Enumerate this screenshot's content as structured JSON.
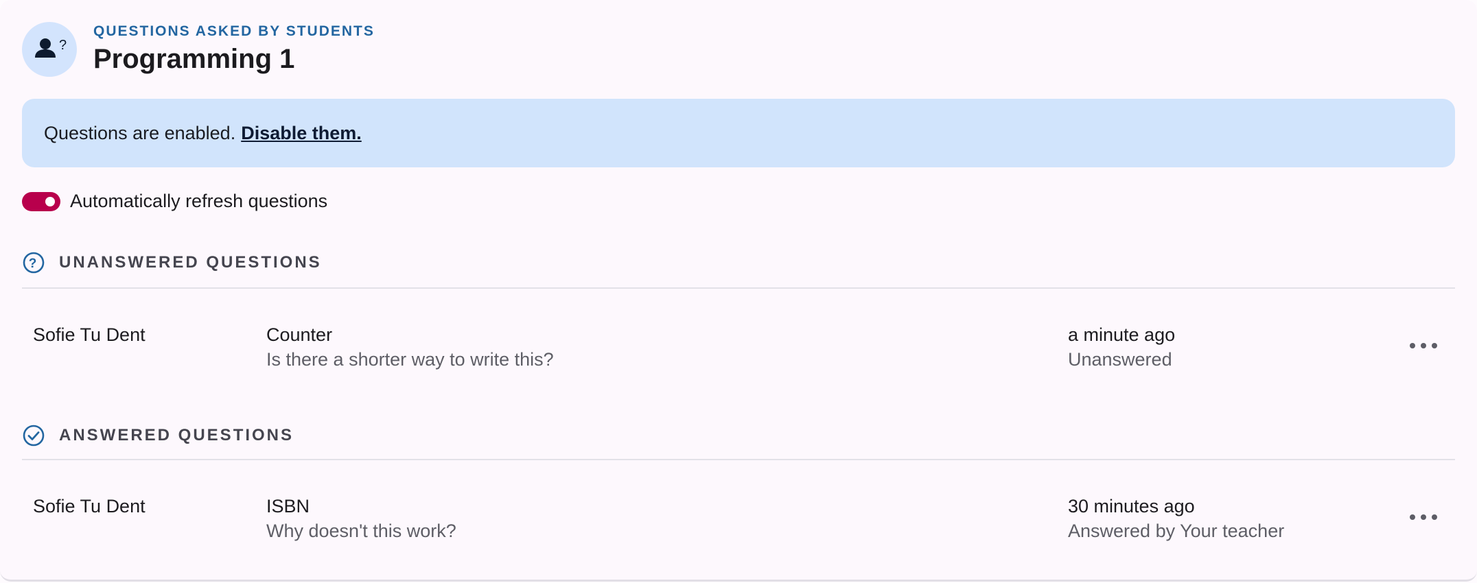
{
  "header": {
    "overline": "QUESTIONS ASKED BY STUDENTS",
    "title": "Programming 1",
    "icon": "person-question-icon"
  },
  "banner": {
    "text": "Questions are enabled.",
    "link": "Disable them."
  },
  "toggle": {
    "label": "Automatically refresh questions",
    "on": true,
    "color": "#b8004c"
  },
  "unanswered": {
    "heading": "UNANSWERED QUESTIONS",
    "icon": "help-circle-icon",
    "items": [
      {
        "author": "Sofie Tu Dent",
        "title": "Counter",
        "question": "Is there a shorter way to write this?",
        "time": "a minute ago",
        "status": "Unanswered"
      }
    ]
  },
  "answered": {
    "heading": "ANSWERED QUESTIONS",
    "icon": "check-circle-icon",
    "items": [
      {
        "author": "Sofie Tu Dent",
        "title": "ISBN",
        "question": "Why doesn't this work?",
        "time": "30 minutes ago",
        "status": "Answered by Your teacher"
      }
    ]
  },
  "colors": {
    "accent": "#2366a1",
    "banner_bg": "#d1e4fc",
    "avatar_bg": "#d3e4fd"
  }
}
